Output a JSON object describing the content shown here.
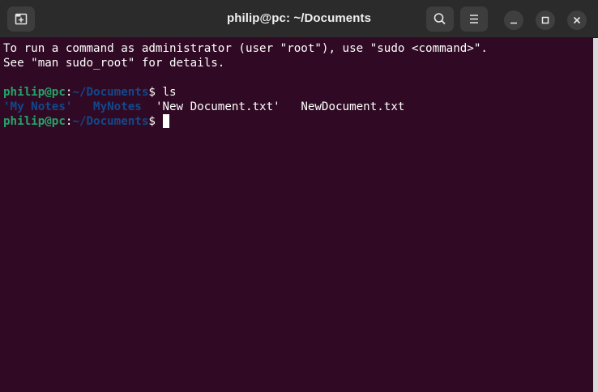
{
  "window": {
    "title": "philip@pc: ~/Documents"
  },
  "titlebar": {
    "new_tab_icon": "new-tab-icon",
    "search_icon": "search-icon",
    "menu_icon": "hamburger-menu-icon",
    "minimize_icon": "minimize-icon",
    "maximize_icon": "maximize-icon",
    "close_icon": "close-icon"
  },
  "terminal": {
    "info_line1": "To run a command as administrator (user \"root\"), use \"sudo <command>\".",
    "info_line2": "See \"man sudo_root\" for details.",
    "prompt1": {
      "user_host": "philip@pc",
      "sep": ":",
      "path": "~/Documents",
      "symbol": "$",
      "command": " ls"
    },
    "ls_output": [
      {
        "text": "'My Notes'",
        "kind": "dir"
      },
      {
        "text": "MyNotes",
        "kind": "dir"
      },
      {
        "text": "'New Document.txt'",
        "kind": "file"
      },
      {
        "text": "NewDocument.txt",
        "kind": "file"
      }
    ],
    "prompt2": {
      "user_host": "philip@pc",
      "sep": ":",
      "path": "~/Documents",
      "symbol": "$",
      "command": " "
    }
  },
  "colors": {
    "background": "#300a24",
    "titlebar": "#2b2b2b",
    "prompt_user": "#26a269",
    "prompt_path": "#12488b",
    "text": "#ffffff"
  }
}
